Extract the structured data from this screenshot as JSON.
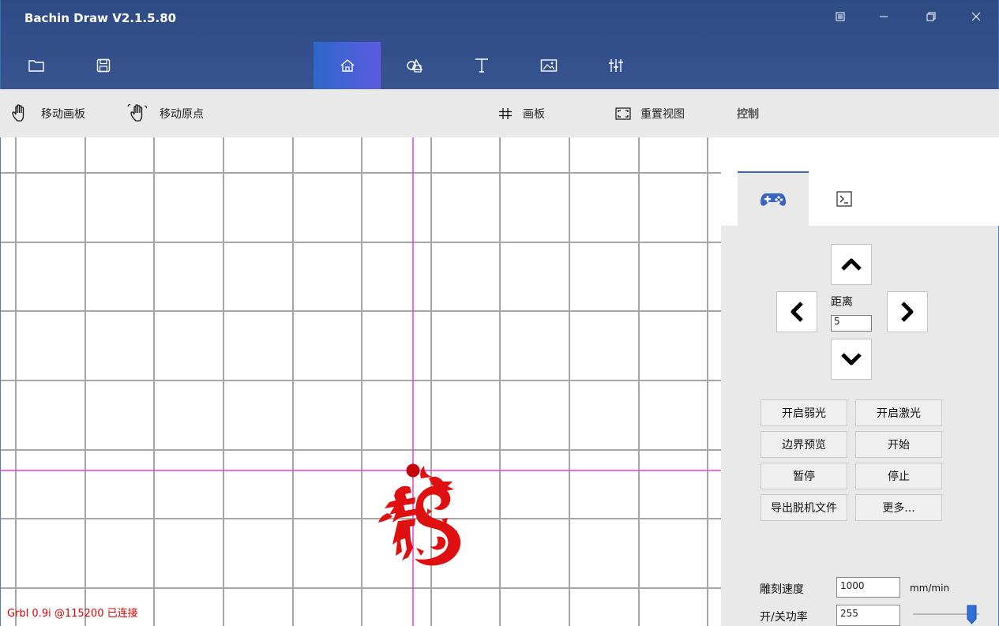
{
  "window": {
    "title": "Bachin Draw V2.1.5.80"
  },
  "toolbar": {
    "file_icon": "folder-icon",
    "save_icon": "save-icon",
    "tabs": [
      "home-icon",
      "shapes-icon",
      "text-icon",
      "image-icon",
      "settings-sliders-icon"
    ],
    "active_tab": "home-icon",
    "accent": "#2e67c9"
  },
  "canvas_toolbar": {
    "move_board": "移动画板",
    "move_origin": "移动原点",
    "board": "画板",
    "reset_view": "重置视图"
  },
  "canvas": {
    "status": "Grbl 0.9i @115200 已连接",
    "grid_color": "#a6a6a6",
    "axis_color": "#e23be0",
    "origin_color": "#c8000c"
  },
  "panel": {
    "title": "控制",
    "tabs": [
      "gamepad-icon",
      "terminal-icon"
    ],
    "distance_label": "距离",
    "distance_value": "5",
    "buttons": {
      "weak_light": "开启弱光",
      "laser_on": "开启激光",
      "boundary_preview": "边界预览",
      "start": "开始",
      "pause": "暂停",
      "stop": "停止",
      "export_offline": "导出脱机文件",
      "more": "更多..."
    },
    "speed_label": "雕刻速度",
    "speed_value": "1000",
    "speed_unit": "mm/min",
    "power_label": "开/关功率",
    "power_value": "255"
  }
}
